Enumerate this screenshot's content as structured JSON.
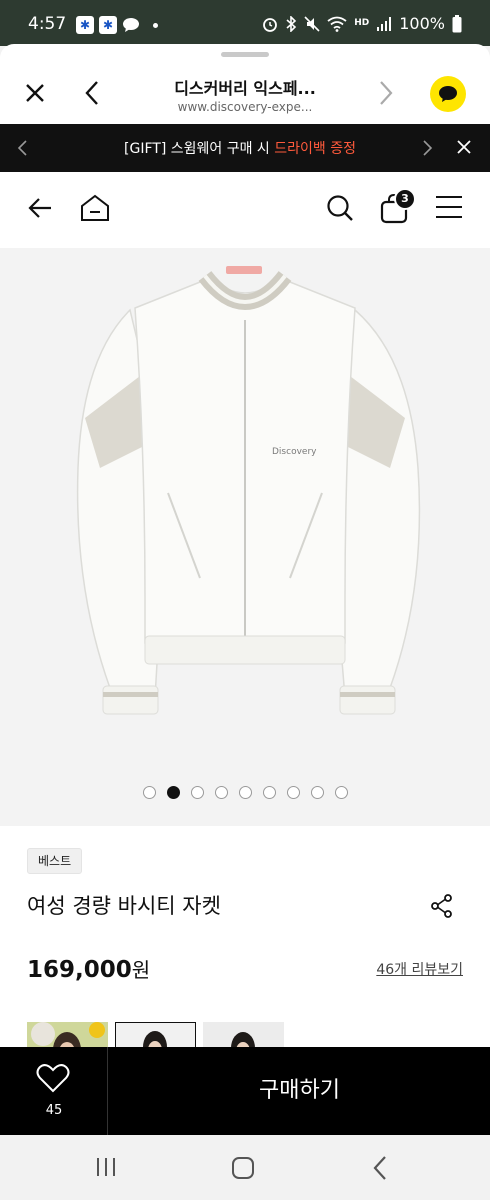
{
  "status_bar": {
    "time": "4:57",
    "notification_icons": [
      "asterisk-app-icon",
      "asterisk-app-icon",
      "chat-bubble-icon"
    ],
    "right_icons": [
      "alarm-icon",
      "bluetooth-icon",
      "mute-icon",
      "wifi-icon",
      "hd-voice-icon",
      "signal-icon"
    ],
    "hd_label": "HD",
    "battery": "100%"
  },
  "browser": {
    "title": "디스커버리 익스페...",
    "url": "www.discovery-expe..."
  },
  "promo": {
    "text_prefix": "[GIFT] 스윔웨어 구매 시 ",
    "text_highlight": "드라이백 증정",
    "highlight_color": "#ff5a3c"
  },
  "header": {
    "cart_count": "3"
  },
  "product": {
    "image_logo_text": "Discovery",
    "carousel_total": 9,
    "carousel_active": 1,
    "badge": "베스트",
    "name": "여성 경량 바시티 자켓",
    "price": "169,000",
    "price_unit": "원",
    "reviews_link": "46개 리뷰보기"
  },
  "buy_bar": {
    "like_count": "45",
    "buy_label": "구매하기"
  },
  "nav": {
    "icons": [
      "recent-apps-icon",
      "home-icon",
      "back-icon"
    ]
  }
}
